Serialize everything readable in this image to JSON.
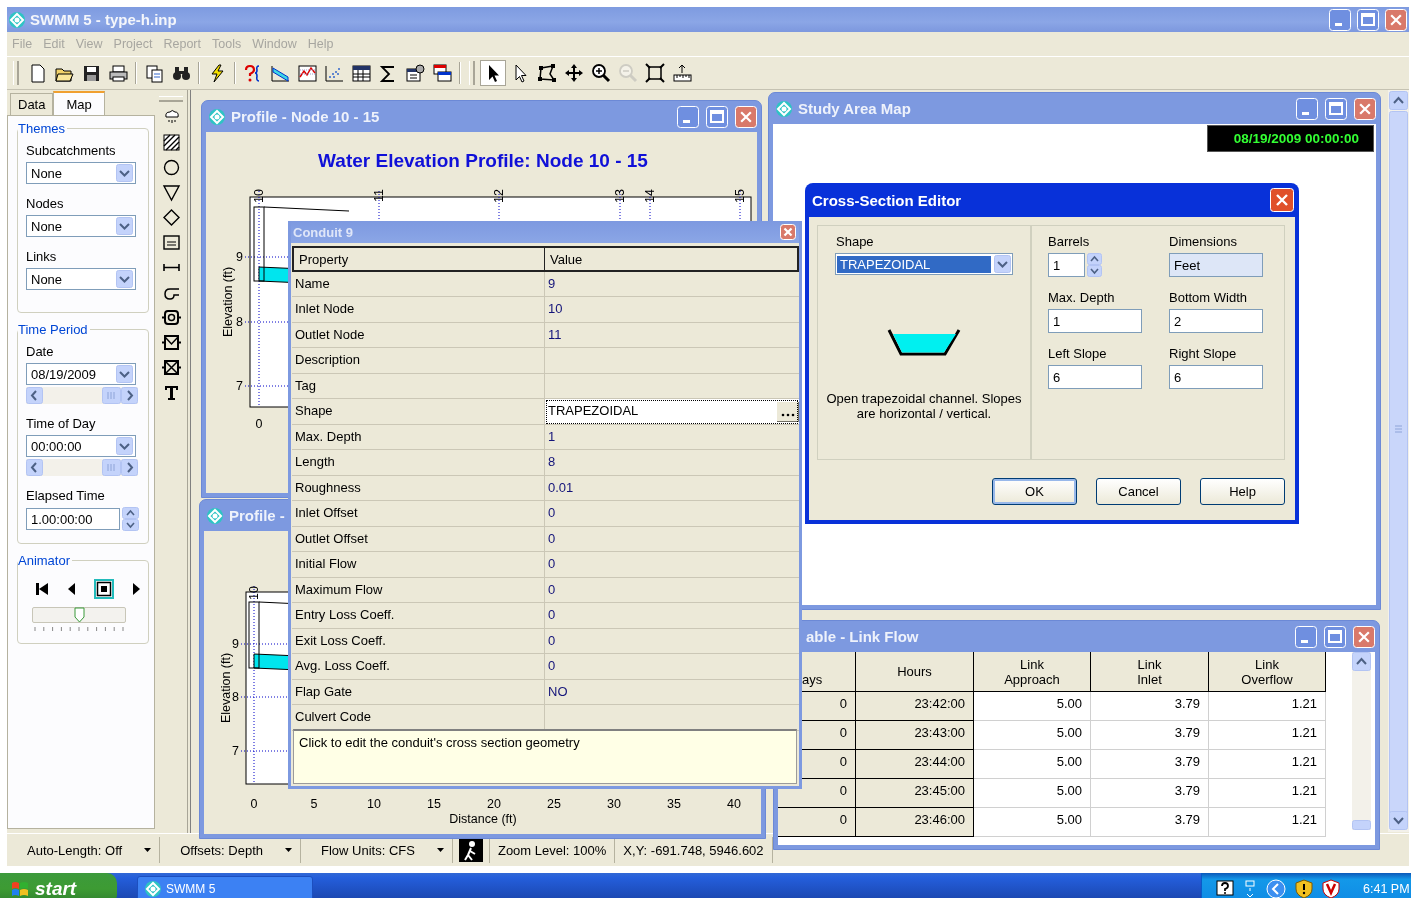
{
  "window": {
    "title": "SWMM 5 - type-h.inp"
  },
  "menu": [
    "File",
    "Edit",
    "View",
    "Project",
    "Report",
    "Tools",
    "Window",
    "Help"
  ],
  "map_tools": [
    {
      "selected": true,
      "disabled": false
    },
    {
      "selected": false,
      "disabled": false
    },
    {
      "selected": false,
      "disabled": false
    },
    {
      "selected": false,
      "disabled": false
    },
    {
      "selected": false,
      "disabled": false
    },
    {
      "selected": false,
      "disabled": true
    },
    {
      "selected": false,
      "disabled": false
    },
    {
      "selected": false,
      "disabled": false
    }
  ],
  "browser": {
    "tabs": [
      {
        "label": "Data",
        "selected": false
      },
      {
        "label": "Map",
        "selected": true
      }
    ],
    "themes": {
      "title": "Themes",
      "selectors": [
        {
          "label": "Subcatchments",
          "value": "None"
        },
        {
          "label": "Nodes",
          "value": "None"
        },
        {
          "label": "Links",
          "value": "None"
        }
      ]
    },
    "time_period": {
      "title": "Time Period",
      "date": {
        "label": "Date",
        "value": "08/19/2009"
      },
      "time_of_day": {
        "label": "Time of Day",
        "value": "00:00:00"
      },
      "elapsed": {
        "label": "Elapsed Time",
        "value": "1.00:00:00"
      }
    },
    "animator": {
      "title": "Animator",
      "level": 0.5
    }
  },
  "profile_windows": [
    {
      "title": "Profile - Node 10 - 15",
      "chart_title": "Water Elevation Profile:  Node 10 - 15",
      "node_labels": [
        "10",
        "11",
        "12",
        "13",
        "14",
        "15"
      ],
      "ylabel": "Elevation (ft)",
      "yticks": [
        "9",
        "8",
        "7"
      ],
      "xticks": [
        "0"
      ]
    },
    {
      "title": "Profile -",
      "node_labels": [
        "10"
      ],
      "ylabel": "Elevation (ft)",
      "yticks": [
        "9",
        "8",
        "7"
      ],
      "xticks": [
        "0",
        "5",
        "10",
        "15",
        "20",
        "25",
        "30",
        "35",
        "40"
      ],
      "xlabel": "Distance (ft)"
    }
  ],
  "conduit": {
    "title": "Conduit 9",
    "columns": [
      "Property",
      "Value"
    ],
    "rows": [
      {
        "property": "Name",
        "value": "9",
        "selected": false
      },
      {
        "property": "Inlet Node",
        "value": "10",
        "selected": false
      },
      {
        "property": "Outlet Node",
        "value": "11",
        "selected": false
      },
      {
        "property": "Description",
        "selected": false
      },
      {
        "property": "Tag",
        "selected": false
      },
      {
        "property": "Shape",
        "value": "TRAPEZOIDAL",
        "selected": true
      },
      {
        "property": "Max. Depth",
        "value": "1",
        "selected": false
      },
      {
        "property": "Length",
        "value": "8",
        "selected": false
      },
      {
        "property": "Roughness",
        "value": "0.01",
        "selected": false
      },
      {
        "property": "Inlet Offset",
        "value": "0",
        "selected": false
      },
      {
        "property": "Outlet Offset",
        "value": "0",
        "selected": false
      },
      {
        "property": "Initial Flow",
        "value": "0",
        "selected": false
      },
      {
        "property": "Maximum Flow",
        "value": "0",
        "selected": false
      },
      {
        "property": "Entry Loss Coeff.",
        "value": "0",
        "selected": false
      },
      {
        "property": "Exit Loss Coeff.",
        "value": "0",
        "selected": false
      },
      {
        "property": "Avg. Loss Coeff.",
        "value": "0",
        "selected": false
      },
      {
        "property": "Flap Gate",
        "value": "NO",
        "selected": false
      },
      {
        "property": "Culvert Code",
        "selected": false
      }
    ],
    "hint": "Click to edit the conduit's cross section geometry"
  },
  "study_map": {
    "title": "Study Area Map",
    "clock": "08/19/2009 00:00:00"
  },
  "xsection_editor": {
    "title": "Cross-Section Editor",
    "shape": {
      "label": "Shape",
      "value": "TRAPEZOIDAL"
    },
    "description": "Open trapezoidal channel. Slopes are horizontal / vertical.",
    "fields": [
      {
        "label": "Barrels",
        "value": "1",
        "kind": "spinner"
      },
      {
        "label": "Dimensions",
        "value": "Feet",
        "kind": "readonly"
      },
      {
        "label": "Max. Depth",
        "value": "1",
        "kind": "text"
      },
      {
        "label": "Bottom Width",
        "value": "2",
        "kind": "text"
      },
      {
        "label": "Left Slope",
        "value": "6",
        "kind": "text"
      },
      {
        "label": "Right Slope",
        "value": "6",
        "kind": "text"
      }
    ],
    "buttons": [
      "OK",
      "Cancel",
      "Help"
    ]
  },
  "link_table": {
    "title": "able - Link Flow",
    "columns": [
      "ays",
      "Hours",
      "Link\nApproach",
      "Link\nInlet",
      "Link\nOverflow"
    ],
    "rows": [
      [
        "0",
        "23:42:00",
        "5.00",
        "3.79",
        "1.21"
      ],
      [
        "0",
        "23:43:00",
        "5.00",
        "3.79",
        "1.21"
      ],
      [
        "0",
        "23:44:00",
        "5.00",
        "3.79",
        "1.21"
      ],
      [
        "0",
        "23:45:00",
        "5.00",
        "3.79",
        "1.21"
      ],
      [
        "0",
        "23:46:00",
        "5.00",
        "3.79",
        "1.21"
      ]
    ]
  },
  "status_bar": [
    {
      "kind": "dropdown",
      "text": "Auto-Length: Off"
    },
    {
      "kind": "dropdown",
      "text": "Offsets: Depth"
    },
    {
      "kind": "dropdown",
      "text": "Flow Units: CFS"
    },
    {
      "kind": "icon"
    },
    {
      "kind": "text",
      "text": "Zoom Level: 100%"
    },
    {
      "kind": "text",
      "text": "X,Y: -691.748, 5946.602"
    }
  ],
  "taskbar": {
    "start": "start",
    "tasks": [
      {
        "label": "SWMM 5",
        "selected": false
      }
    ],
    "clock": "6:41 PM"
  }
}
